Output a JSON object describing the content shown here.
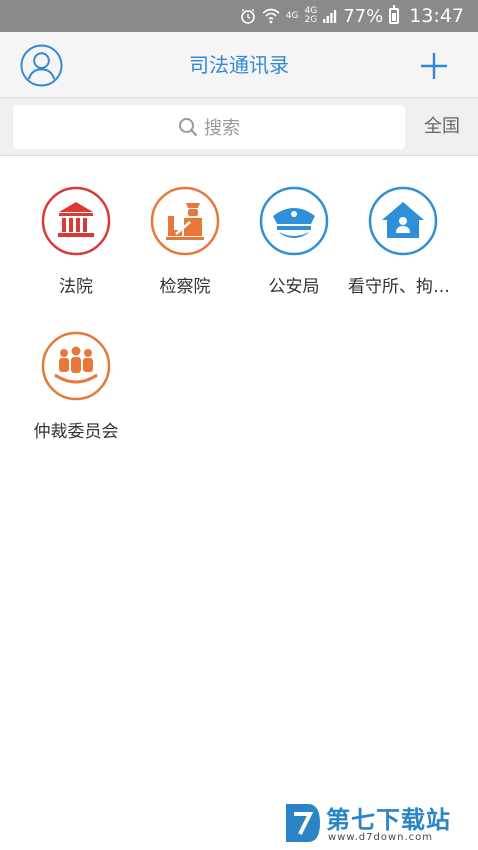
{
  "status_bar": {
    "net_top": "4G",
    "net_second_top": "4G",
    "net_second_bottom": "2G",
    "battery": "77%",
    "time": "13:47"
  },
  "app_bar": {
    "title": "司法通讯录"
  },
  "search": {
    "placeholder": "搜索",
    "region": "全国"
  },
  "categories": [
    {
      "label": "法院",
      "icon": "courthouse-icon",
      "color": "#d93a35"
    },
    {
      "label": "检察院",
      "icon": "prosecutor-icon",
      "color": "#e8783a"
    },
    {
      "label": "公安局",
      "icon": "police-cap-icon",
      "color": "#2f8fd8"
    },
    {
      "label": "看守所、拘留所",
      "icon": "house-person-icon",
      "color": "#2f8fd8"
    },
    {
      "label": "仲裁委员会",
      "icon": "people-group-icon",
      "color": "#e8783a"
    }
  ],
  "watermark": {
    "text": "第七下载站",
    "url": "www.d7down.com"
  }
}
